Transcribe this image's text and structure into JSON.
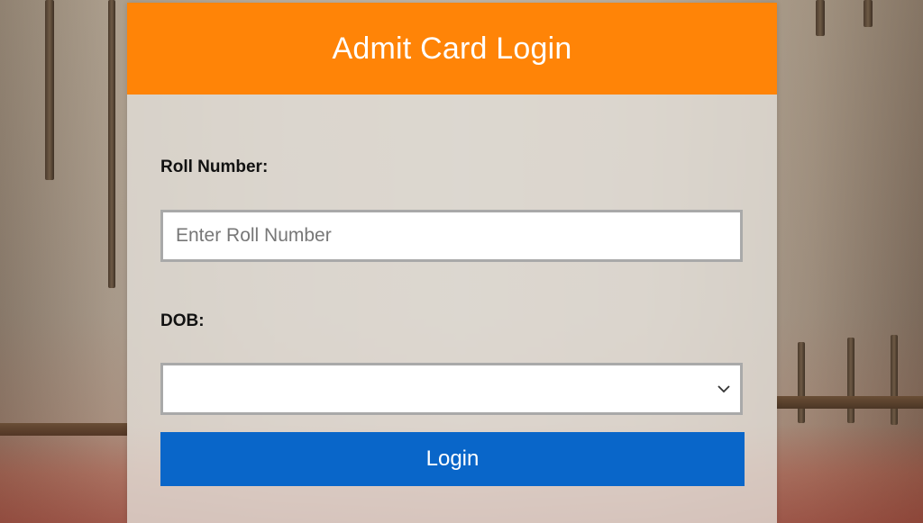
{
  "card": {
    "title": "Admit Card Login"
  },
  "form": {
    "roll_label": "Roll Number:",
    "roll_placeholder": "Enter Roll Number",
    "roll_value": "",
    "dob_label": "DOB:",
    "dob_selected": "",
    "login_label": "Login"
  },
  "colors": {
    "header": "#ff8407",
    "button": "#0966c9"
  },
  "icons": {
    "select_arrow": "chevron-down-icon"
  }
}
